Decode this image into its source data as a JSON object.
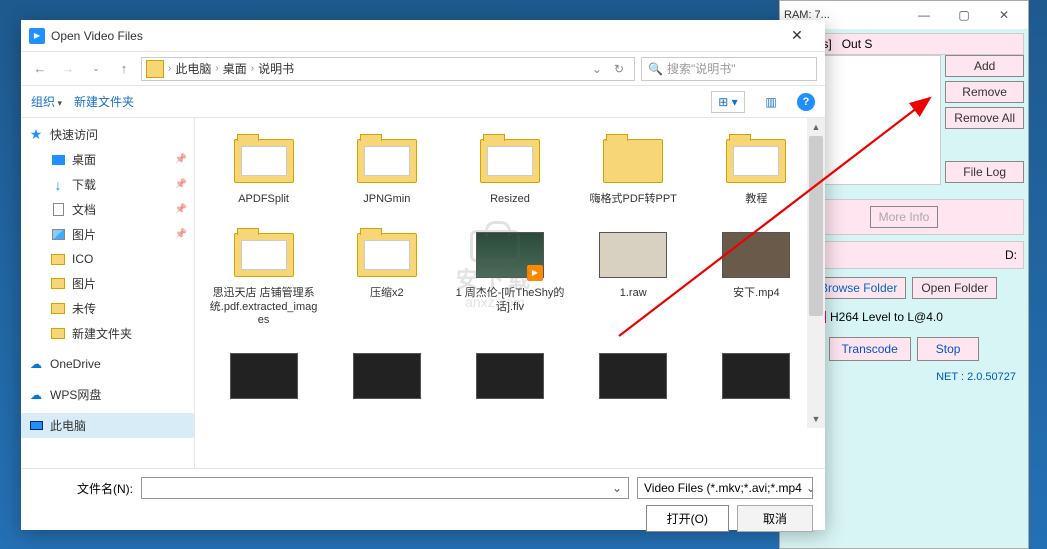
{
  "bg": {
    "title": "RAM: 7...",
    "headers": {
      "status": "[Status]",
      "outsize": "Out S"
    },
    "buttons": {
      "add": "Add",
      "remove": "Remove",
      "removeAll": "Remove All",
      "fileLog": "File Log",
      "moreInfo": "More Info",
      "browseFolder": "Browse Folder",
      "openFolder": "Open Folder",
      "transcode": "Transcode",
      "stop": "Stop"
    },
    "drive": "D:",
    "h264": "H264 Level to L@4.0",
    "net": "NET :  2.0.50727"
  },
  "dialog": {
    "title": "Open Video Files",
    "breadcrumb": {
      "root": "此电脑",
      "b1": "桌面",
      "b2": "说明书"
    },
    "searchPlaceholder": "搜索\"说明书\"",
    "toolbar": {
      "organize": "组织",
      "newfolder": "新建文件夹"
    },
    "sidebar": {
      "quick": "快速访问",
      "desktop": "桌面",
      "downloads": "下载",
      "docs": "文档",
      "pics": "图片",
      "ico": "ICO",
      "tupian": "图片",
      "weichuan": "未传",
      "newfolder": "新建文件夹",
      "onedrive": "OneDrive",
      "wps": "WPS网盘",
      "thispc": "此电脑"
    },
    "files": {
      "f0": "APDFSplit",
      "f1": "JPNGmin",
      "f2": "Resized",
      "f3": "嗨格式PDF转PPT",
      "f4": "教程",
      "f5": "思迅天店 店铺管理系统.pdf.extracted_images",
      "f6": "压缩x2",
      "f7": "1 周杰伦-[听TheShy的话].flv",
      "f8": "1.raw",
      "f9": "安下.mp4"
    },
    "footer": {
      "filenameLabel": "文件名(N):",
      "filter": "Video Files (*.mkv;*.avi;*.mp4",
      "open": "打开(O)",
      "cancel": "取消"
    }
  },
  "watermark": {
    "txt": "安下载",
    "url": "anxz.com"
  }
}
